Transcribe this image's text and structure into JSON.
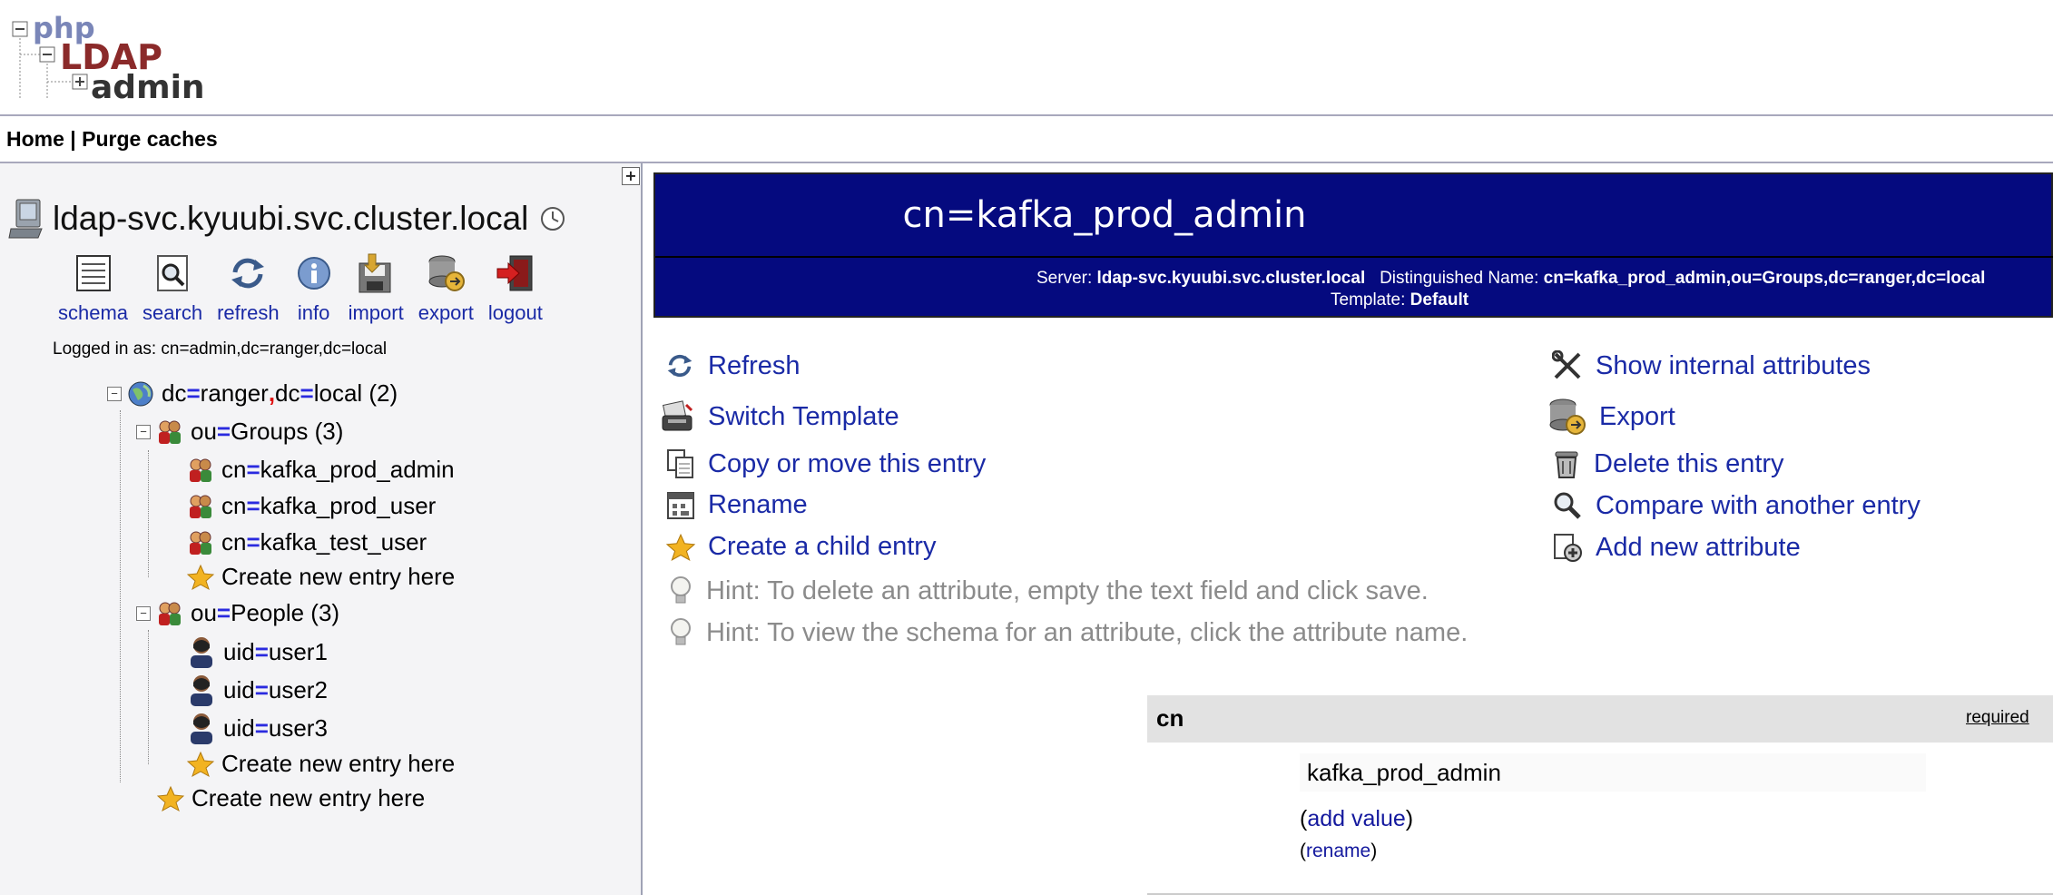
{
  "logo": {
    "line1": "php",
    "line2": "LDAP",
    "line3": "admin"
  },
  "topnav": {
    "home": "Home",
    "sep": " | ",
    "purge": "Purge caches"
  },
  "server": {
    "name": "ldap-svc.kyuubi.svc.cluster.local"
  },
  "toolbar": [
    {
      "label": "schema",
      "icon": "schema-icon"
    },
    {
      "label": "search",
      "icon": "search-icon"
    },
    {
      "label": "refresh",
      "icon": "refresh-icon"
    },
    {
      "label": "info",
      "icon": "info-icon"
    },
    {
      "label": "import",
      "icon": "import-icon"
    },
    {
      "label": "export",
      "icon": "export-icon"
    },
    {
      "label": "logout",
      "icon": "logout-icon"
    }
  ],
  "logged_in": "Logged in as: cn=admin,dc=ranger,dc=local",
  "tree": {
    "root": {
      "k1": "dc",
      "v1": "ranger",
      "k2": "dc",
      "v2": "local (2)"
    },
    "groups": {
      "k": "ou",
      "v": "Groups (3)"
    },
    "groups_children": [
      {
        "k": "cn",
        "v": "kafka_prod_admin"
      },
      {
        "k": "cn",
        "v": "kafka_prod_user"
      },
      {
        "k": "cn",
        "v": "kafka_test_user"
      }
    ],
    "people": {
      "k": "ou",
      "v": "People (3)"
    },
    "people_children": [
      {
        "k": "uid",
        "v": "user1"
      },
      {
        "k": "uid",
        "v": "user2"
      },
      {
        "k": "uid",
        "v": "user3"
      }
    ],
    "create_new": "Create new entry here"
  },
  "entry": {
    "title": "cn=kafka_prod_admin",
    "server_label": "Server:",
    "server_value": "ldap-svc.kyuubi.svc.cluster.local",
    "dn_label": "Distinguished Name:",
    "dn_value": "cn=kafka_prod_admin,ou=Groups,dc=ranger,dc=local",
    "template_label": "Template:",
    "template_value": "Default"
  },
  "actions_left": [
    {
      "label": "Refresh",
      "icon": "refresh-icon"
    },
    {
      "label": "Switch Template",
      "icon": "switch-template-icon"
    },
    {
      "label": "Copy or move this entry",
      "icon": "copy-icon"
    },
    {
      "label": "Rename",
      "icon": "rename-icon"
    },
    {
      "label": "Create a child entry",
      "icon": "star-icon"
    }
  ],
  "hints": [
    "Hint: To delete an attribute, empty the text field and click save.",
    "Hint: To view the schema for an attribute, click the attribute name."
  ],
  "actions_right": [
    {
      "label": "Show internal attributes",
      "icon": "tools-icon"
    },
    {
      "label": "Export",
      "icon": "export-icon"
    },
    {
      "label": "Delete this entry",
      "icon": "trash-icon"
    },
    {
      "label": "Compare with another entry",
      "icon": "compare-icon"
    },
    {
      "label": "Add new attribute",
      "icon": "add-attribute-icon"
    }
  ],
  "attribute": {
    "name": "cn",
    "required": "required",
    "value": "kafka_prod_admin",
    "add_value": "add value",
    "rename": "rename"
  }
}
